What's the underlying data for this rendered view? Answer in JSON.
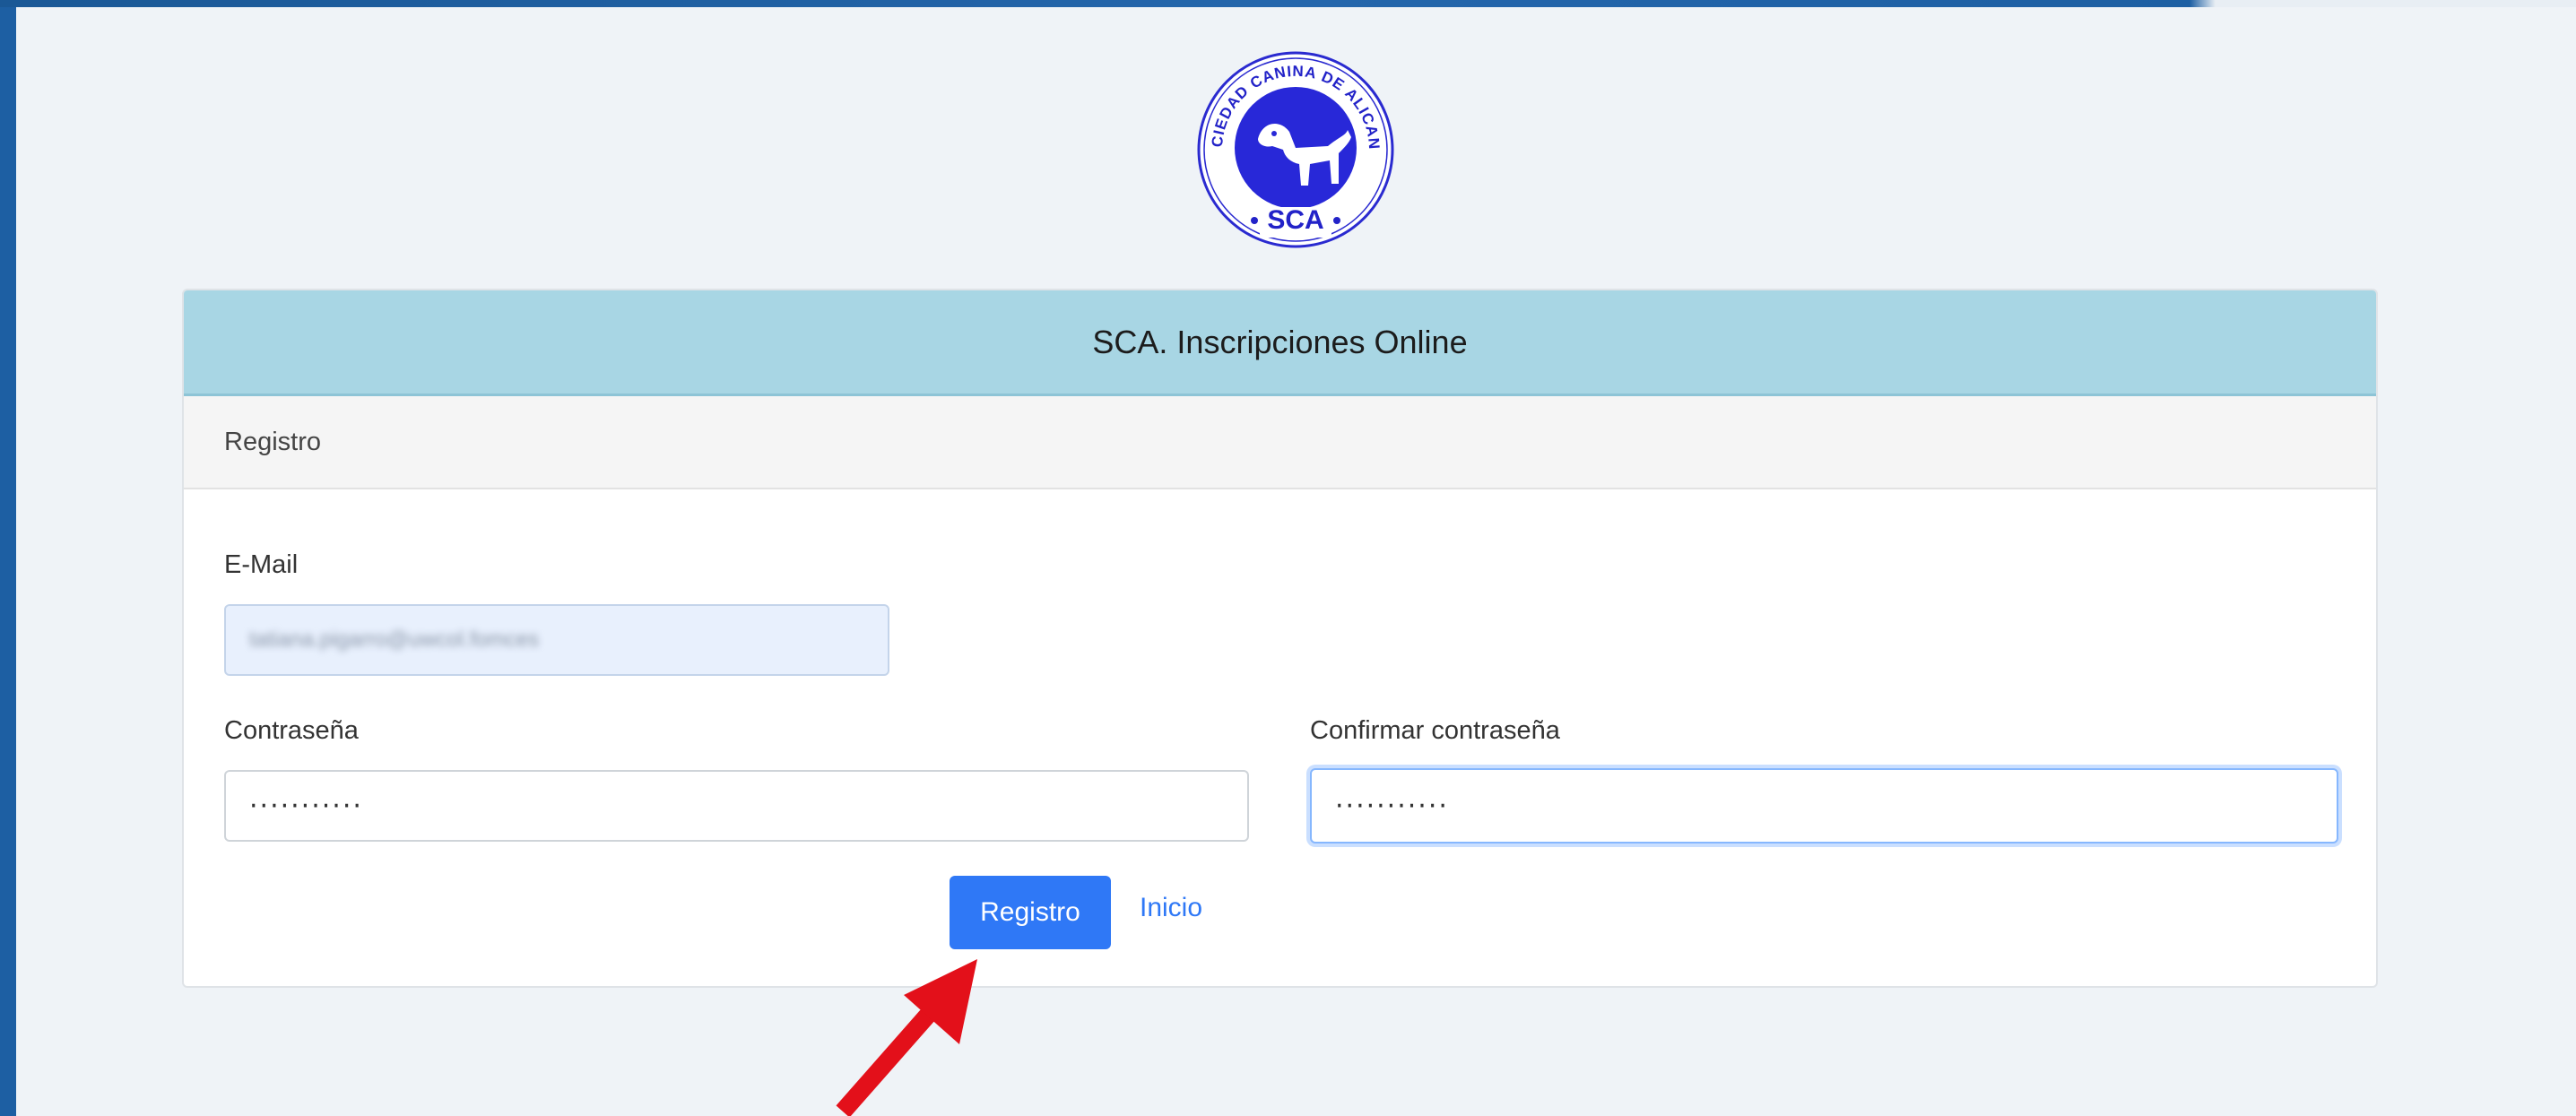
{
  "app": {
    "logo_top_text": "SOCIEDAD CANINA DE ALICANTE",
    "logo_initials": "SCA"
  },
  "card": {
    "title": "SCA. Inscripciones Online",
    "section_title": "Registro"
  },
  "form": {
    "email_label": "E-Mail",
    "email_value": "tatiana.pigarro@uwcol.fomces",
    "password_label": "Contraseña",
    "password_value": "···········",
    "confirm_label": "Confirmar contraseña",
    "confirm_value": "···········",
    "register_button": "Registro",
    "home_link": "Inicio"
  },
  "colors": {
    "page_border": "#1d5fa3",
    "background": "#eff3f7",
    "title_bar": "#a8d6e4",
    "primary": "#2f78f6",
    "arrow": "#e3101a",
    "logo_blue": "#2828d8"
  },
  "icons": {
    "annotation": "red-arrow-icon"
  }
}
